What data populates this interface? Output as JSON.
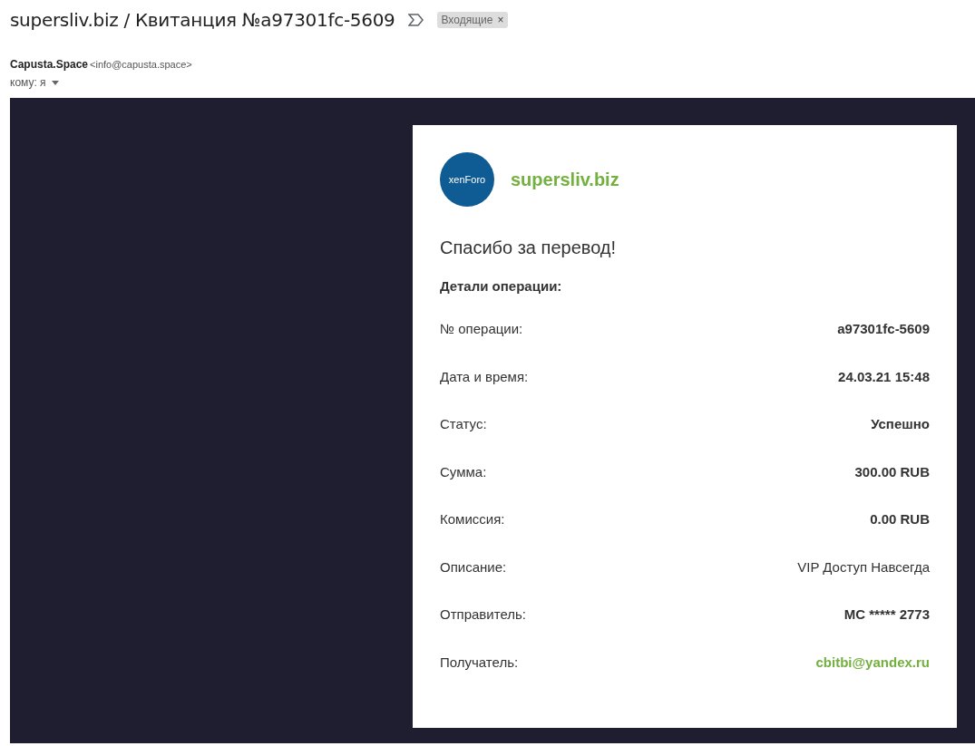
{
  "subject": {
    "title": "supersliv.biz / Квитанция №a97301fc-5609",
    "label": "Входящие",
    "label_close": "×"
  },
  "sender": {
    "name": "Capusta.Space",
    "address": "<info@capusta.space>",
    "to": "кому: я"
  },
  "receipt": {
    "logo_text": "xenForo",
    "site": "supersliv.biz",
    "heading": "Спасибо за перевод!",
    "section": "Детали операции:",
    "rows": [
      {
        "label": "№ операции:",
        "value": "a97301fc-5609",
        "kind": "bold"
      },
      {
        "label": "Дата и время:",
        "value": "24.03.21 15:48",
        "kind": "bold"
      },
      {
        "label": "Статус:",
        "value": "Успешно",
        "kind": "bold"
      },
      {
        "label": "Сумма:",
        "value": "300.00 RUB",
        "kind": "bold"
      },
      {
        "label": "Комиссия:",
        "value": "0.00 RUB",
        "kind": "bold"
      },
      {
        "label": "Описание:",
        "value": "VIP Доступ Навсегда",
        "kind": "plain"
      },
      {
        "label": "Отправитель:",
        "value": "MC ***** 2773",
        "kind": "bold"
      },
      {
        "label": "Получатель:",
        "value": "cbitbi@yandex.ru",
        "kind": "link"
      }
    ]
  }
}
